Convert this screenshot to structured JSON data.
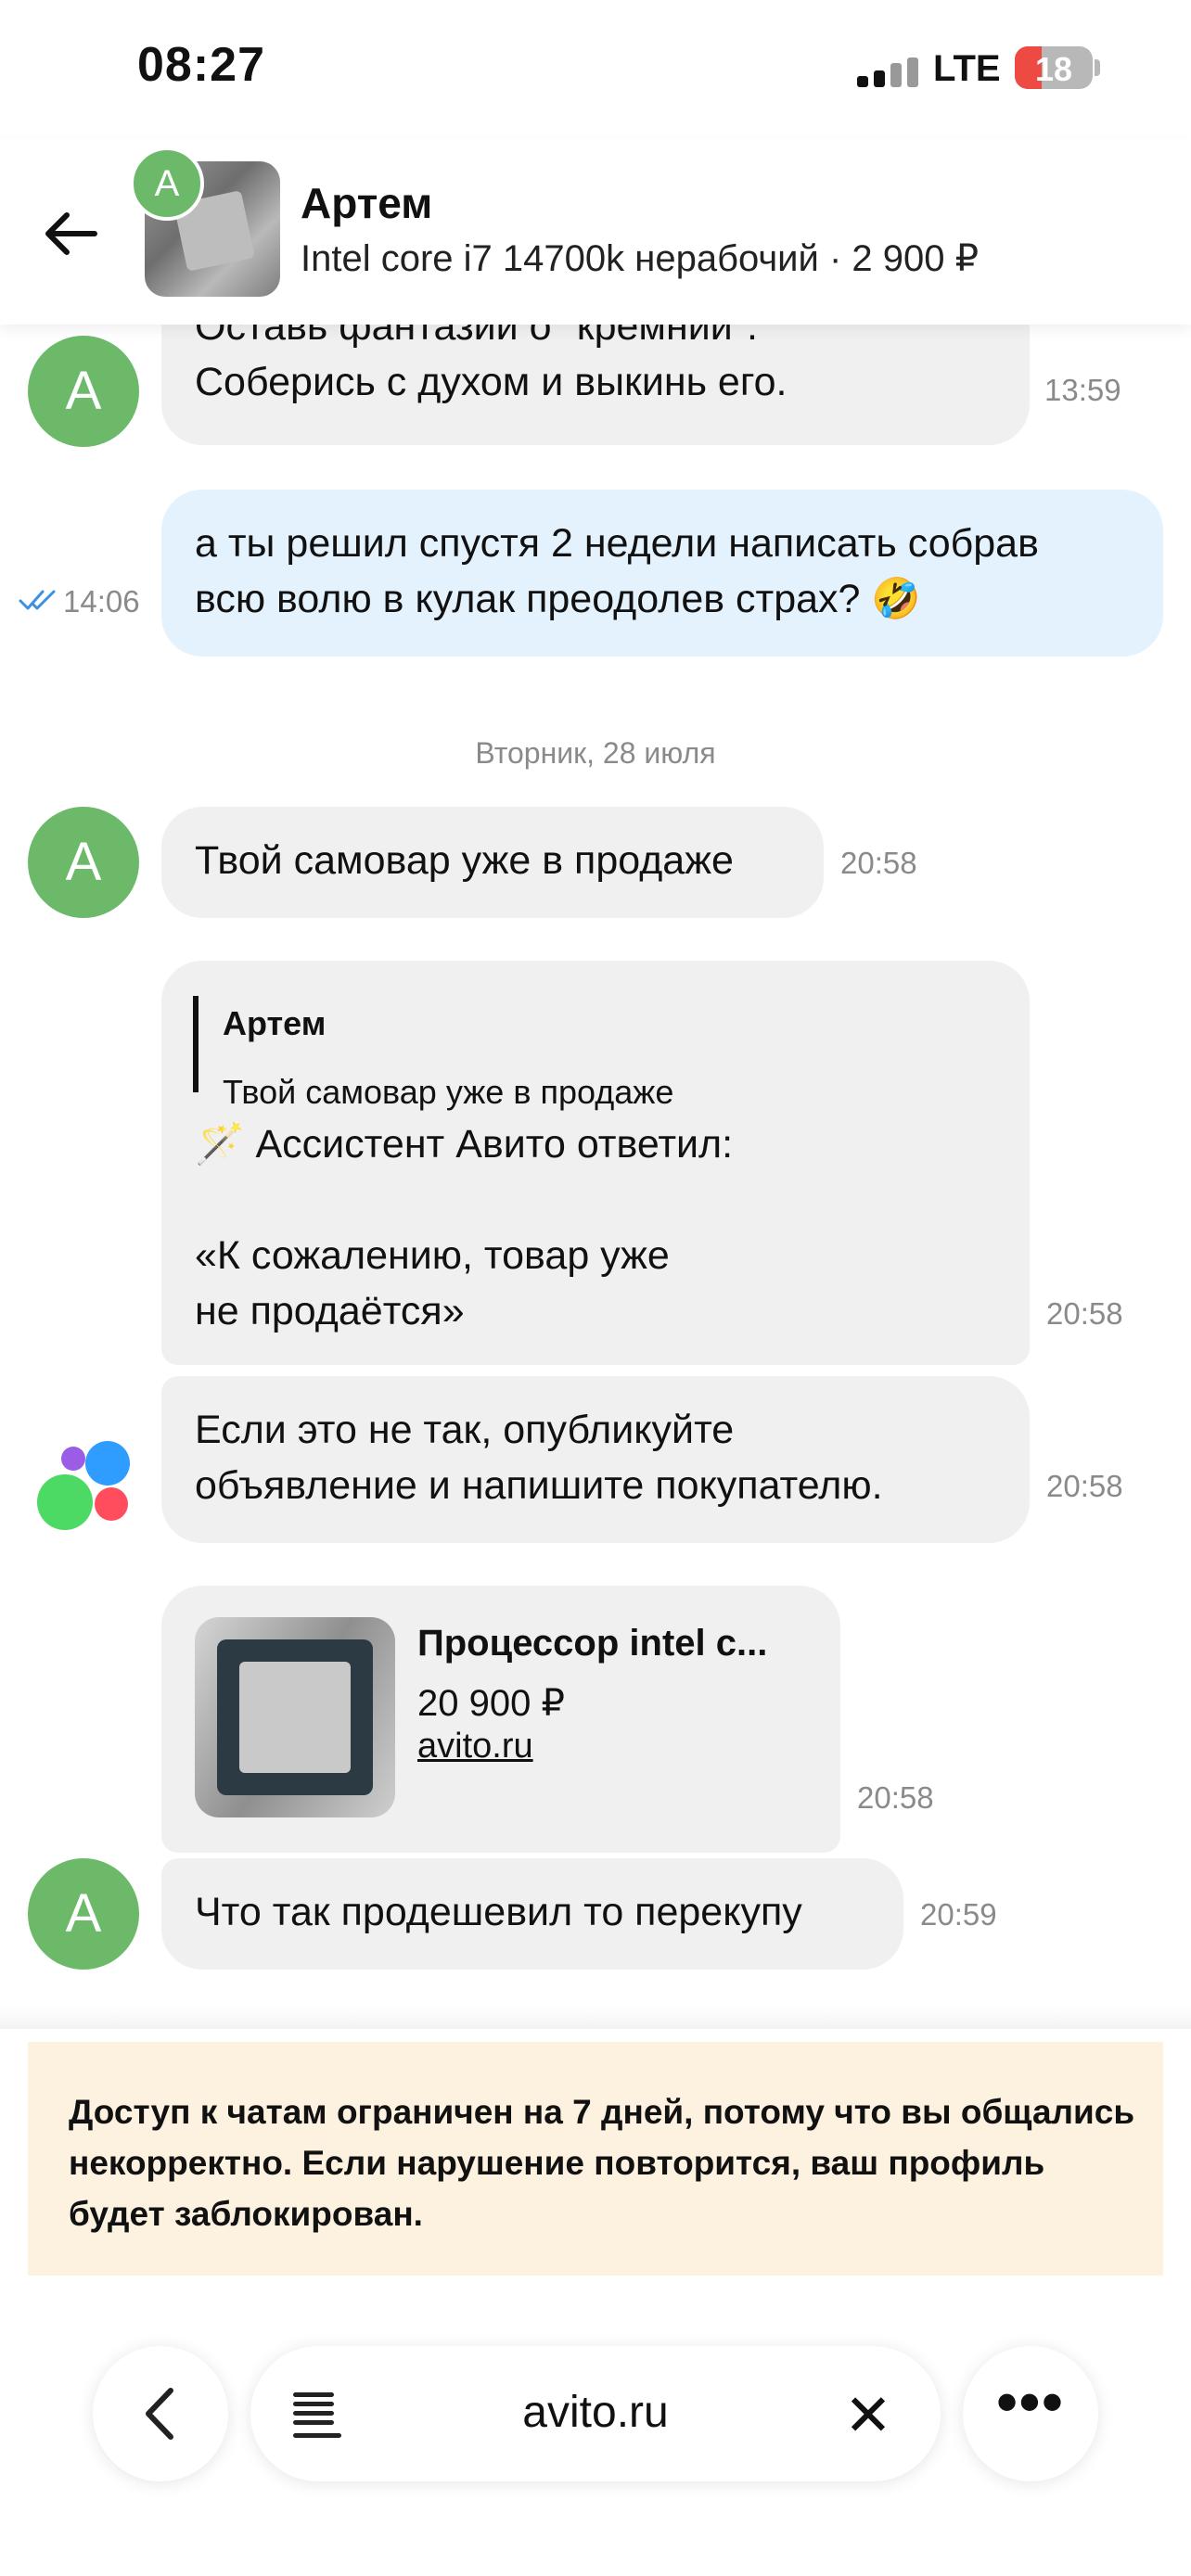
{
  "status_bar": {
    "time": "08:27",
    "network": "LTE",
    "battery": "18"
  },
  "header": {
    "avatar_letter": "А",
    "name": "Артем",
    "subtitle": "Intel core i7 14700k нерабочий · 2 900 ₽"
  },
  "messages": {
    "m1": {
      "line1": "Оставь фантазии о \"кремнии\".",
      "line2": "Соберись с духом и выкинь его.",
      "time": "13:59",
      "avatar": "А"
    },
    "m2": {
      "line1": "а ты решил спустя 2 недели написать собрав",
      "line2": "всю волю в кулак преодолев страх? 🤣",
      "time": "14:06",
      "read_mark": "✓✓"
    },
    "date_separator": "Вторник, 28 июля",
    "m3": {
      "text": "Твой самовар уже в продаже",
      "time": "20:58",
      "avatar": "А"
    },
    "m4": {
      "quote_name": "Артем",
      "quote_text": "Твой самовар уже в продаже",
      "assistant_line": "🪄 Ассистент Авито ответил:",
      "line1": "«К сожалению, товар уже",
      "line2": "не продаётся»",
      "time": "20:58"
    },
    "m5": {
      "line1": "Если это не так, опубликуйте",
      "line2": "объявление и напишите покупателю.",
      "time": "20:58"
    },
    "m6": {
      "title": "Процессор intel c...",
      "price": "20 900 ₽",
      "domain": "avito.ru",
      "time": "20:58"
    },
    "m7": {
      "text": "Что так продешевил то перекупу",
      "time": "20:59",
      "avatar": "А"
    }
  },
  "banner": {
    "text": "Доступ к чатам ограничен на 7 дней, потому что вы общались некорректно. Если нарушение повторится, ваш профиль будет заблокирован."
  },
  "browser": {
    "url": "avito.ru",
    "back_icon": "‹",
    "close_icon": "✕",
    "more_icon": "•••"
  },
  "icons": {
    "back": "arrow-left-icon",
    "reader": "reader-mode-icon",
    "close": "close-icon",
    "more": "more-icon"
  },
  "colors": {
    "avatar_green": "#6db96a",
    "my_bubble": "#e4f2fd",
    "their_bubble": "#f0f0f0",
    "banner_bg": "#fdf1df",
    "read_check": "#3d8fe0"
  }
}
